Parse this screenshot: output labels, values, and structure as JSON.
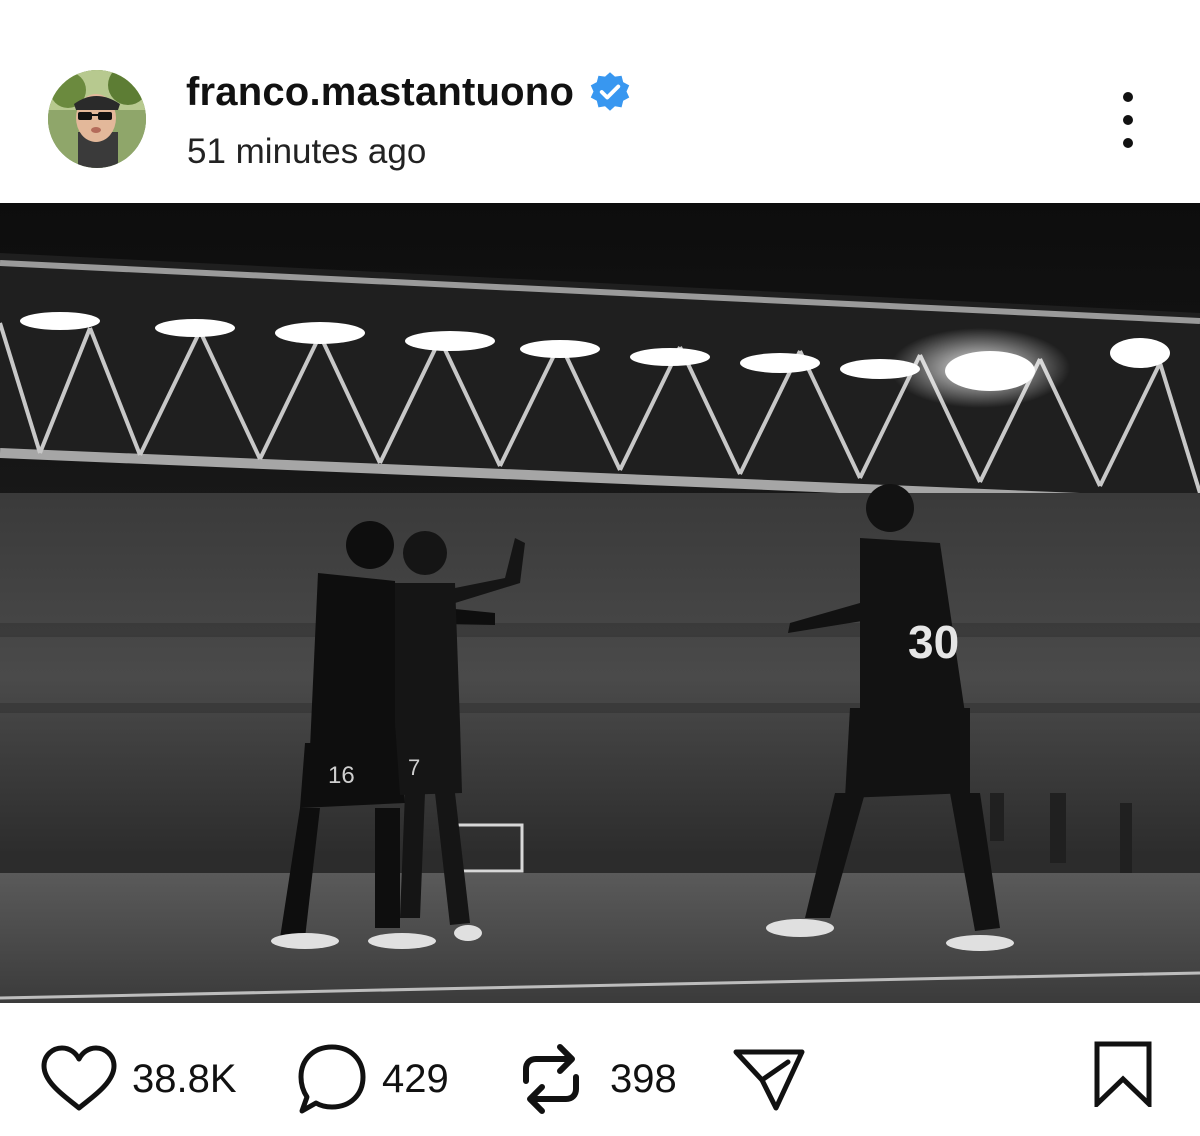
{
  "post": {
    "username": "franco.mastantuono",
    "verified": true,
    "time": "51 minutes ago",
    "icons": {
      "avatar": "profile-avatar",
      "verified": "verified-badge-icon",
      "more": "more-vertical-icon"
    }
  },
  "photo": {
    "description_icon": "stadium-photo",
    "jersey_number_left": "16",
    "jersey_number_right": "30",
    "jersey_number_middle": "7"
  },
  "actions": {
    "likes": "38.8K",
    "comments": "429",
    "reposts": "398",
    "icons": [
      "heart-icon",
      "comment-icon",
      "repost-icon",
      "share-icon",
      "bookmark-icon"
    ]
  },
  "colors": {
    "verified_blue": "#3897f0",
    "text": "#111111",
    "background": "#ffffff"
  }
}
